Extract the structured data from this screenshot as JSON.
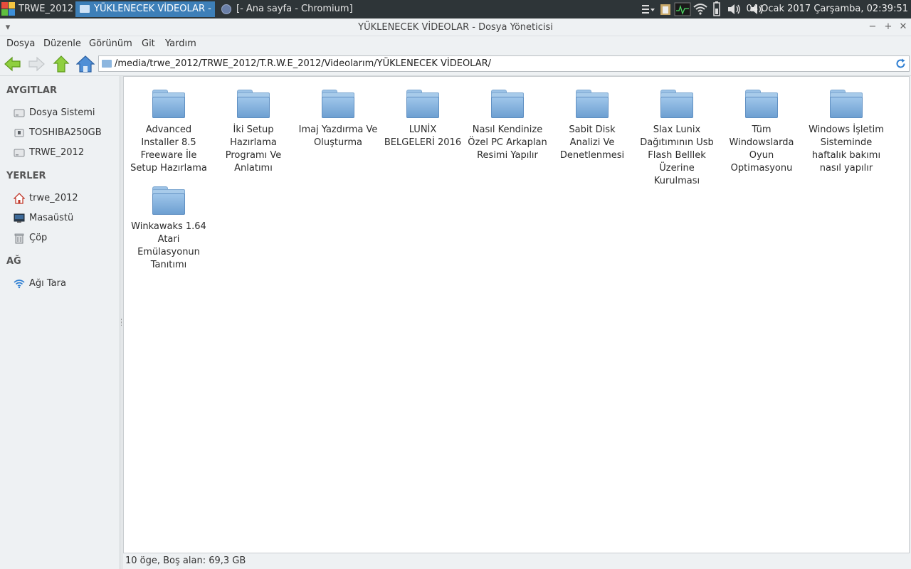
{
  "taskbar": {
    "start_label": "TRWE_2012",
    "tasks": [
      {
        "label": "YÜKLENECEK VİDEOLAR - ..."
      },
      {
        "label": "[- Ana sayfa - Chromium]"
      }
    ],
    "clock": "04 Ocak 2017 Çarşamba, 02:39:51"
  },
  "window": {
    "title": "YÜKLENECEK VİDEOLAR - Dosya Yöneticisi",
    "minimize": "−",
    "maximize": "+",
    "close": "✕"
  },
  "menubar": [
    "Dosya",
    "Düzenle",
    "Görünüm",
    "Git",
    "Yardım"
  ],
  "address": {
    "path": "/media/trwe_2012/TRWE_2012/T.R.W.E_2012/Videolarım/YÜKLENECEK VİDEOLAR/"
  },
  "sidebar": {
    "devices_header": "AYGITLAR",
    "devices": [
      {
        "label": "Dosya Sistemi",
        "icon": "drive-icon"
      },
      {
        "label": "TOSHIBA250GB",
        "icon": "usb-drive-icon"
      },
      {
        "label": "TRWE_2012",
        "icon": "drive-icon"
      }
    ],
    "places_header": "YERLER",
    "places": [
      {
        "label": "trwe_2012",
        "icon": "home-icon"
      },
      {
        "label": "Masaüstü",
        "icon": "desktop-icon"
      },
      {
        "label": "Çöp",
        "icon": "trash-icon"
      }
    ],
    "network_header": "AĞ",
    "network": [
      {
        "label": "Ağı Tara",
        "icon": "network-icon"
      }
    ]
  },
  "files": [
    "Advanced Installer 8.5 Freeware İle Setup Hazırlama",
    "İki Setup Hazırlama Programı Ve Anlatımı",
    "Imaj Yazdırma Ve Oluşturma",
    "LUNİX BELGELERİ 2016",
    "Nasıl Kendinize Özel PC Arkaplan Resimi Yapılır",
    "Sabit Disk Analizi Ve Denetlenmesi",
    "Slax Lunix Dağıtımının Usb Flash Belllek Üzerine Kurulması",
    "Tüm Windowslarda Oyun Optimasyonu",
    "Windows İşletim Sisteminde haftalık bakımı nasıl yapılır",
    "Winkawaks 1.64 Atari Emülasyonun Tanıtımı"
  ],
  "status": "10 öge, Boş alan: 69,3 GB"
}
